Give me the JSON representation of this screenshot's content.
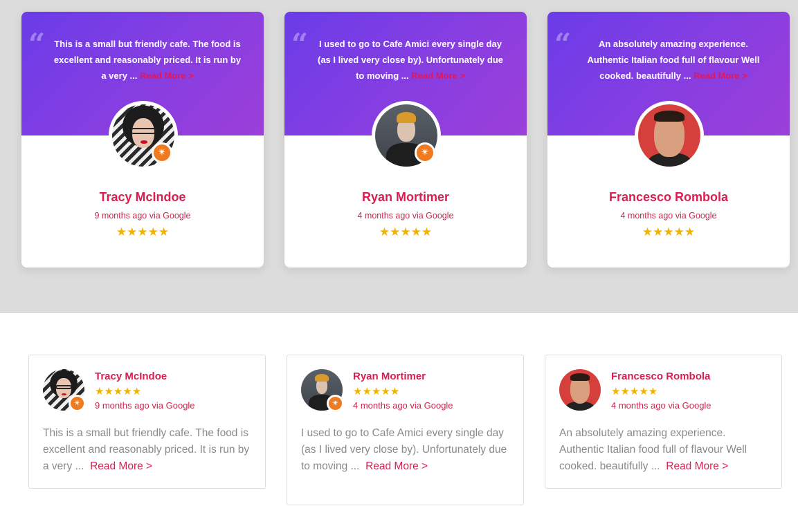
{
  "carousel": {
    "cards": [
      {
        "text": "This is a small but friendly cafe. The food is excellent and reasonably priced. It is run by a very ...",
        "read_more": "Read More >",
        "name": "Tracy McIndoe",
        "meta": "9 months ago via Google",
        "stars": "★★★★★"
      },
      {
        "text": "I used to go to Cafe Amici every single day (as I lived very close by). Unfortunately due to moving ...",
        "read_more": "Read More >",
        "name": "Ryan Mortimer",
        "meta": "4 months ago via Google",
        "stars": "★★★★★"
      },
      {
        "text": "An absolutely amazing experience. Authentic Italian food full of flavour Well cooked. beautifully ...",
        "read_more": "Read More >",
        "name": "Francesco Rombola",
        "meta": "4 months ago via Google",
        "stars": "★★★★★"
      }
    ]
  },
  "list": {
    "cards": [
      {
        "name": "Tracy McIndoe",
        "stars": "★★★★★",
        "meta": "9 months ago via Google",
        "text": "This is a small but friendly cafe. The food is excellent and reasonably priced. It is run by a very ...",
        "read_more": "Read More >"
      },
      {
        "name": "Ryan Mortimer",
        "stars": "★★★★★",
        "meta": "4 months ago via Google",
        "text": "I used to go to Cafe Amici every single day (as I lived very close by). Unfortunately due to moving ...",
        "read_more": "Read More >"
      },
      {
        "name": "Francesco Rombola",
        "stars": "★★★★★",
        "meta": "4 months ago via Google",
        "text": "An absolutely amazing experience. Authentic Italian food full of flavour Well cooked. beautifully ...",
        "read_more": "Read More >"
      }
    ]
  },
  "icons": {
    "quote": "quote-icon",
    "badge": "google-local-guide-badge-icon",
    "star": "star-icon"
  },
  "colors": {
    "banner_gradient_start": "#6a3ce8",
    "banner_gradient_end": "#9b3fd8",
    "accent_pink": "#d81f52",
    "star_gold": "#f2b200",
    "badge_orange": "#ef7a1f"
  }
}
